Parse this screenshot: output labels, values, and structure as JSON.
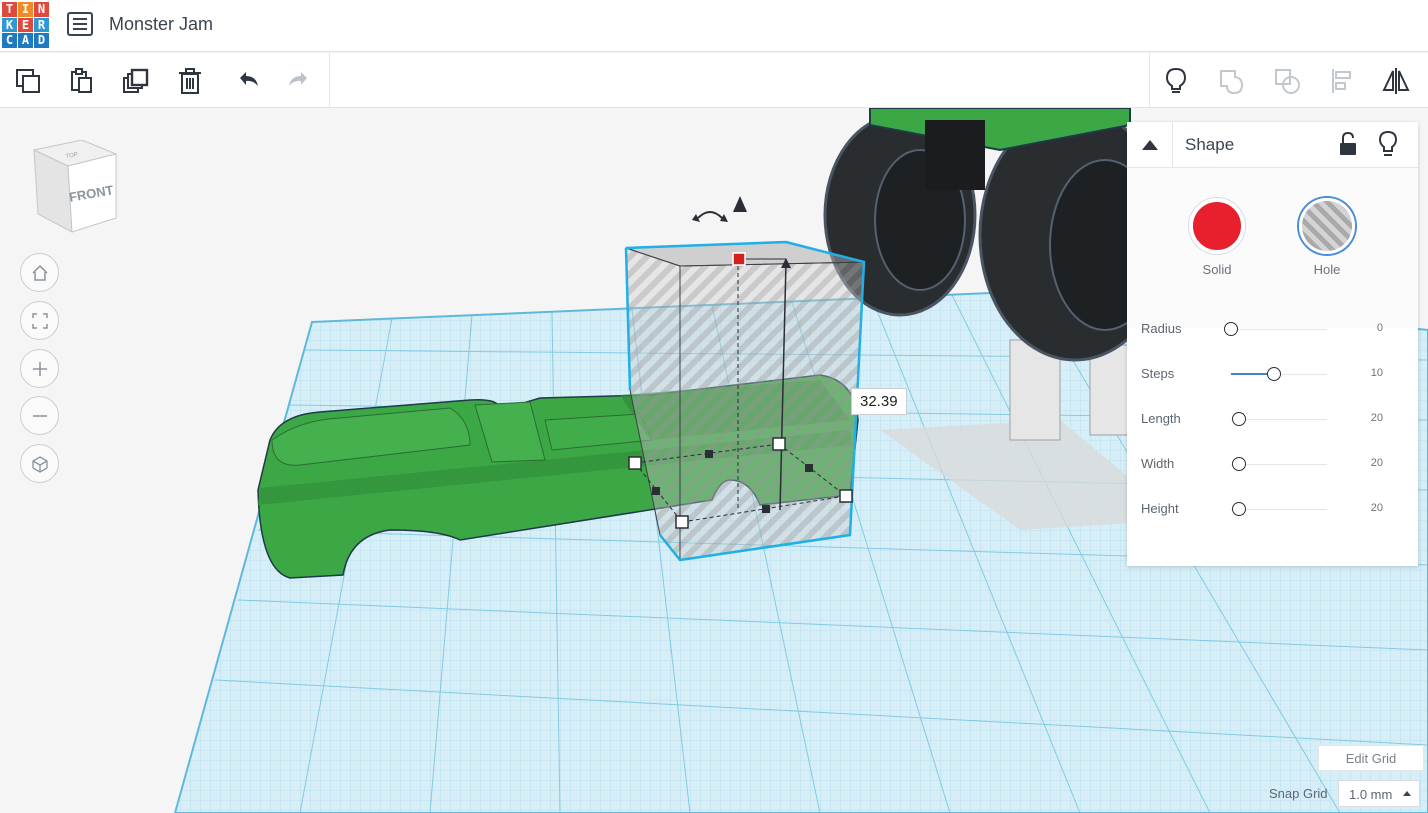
{
  "app": {
    "logo_letters": [
      "T",
      "I",
      "N",
      "K",
      "E",
      "R",
      "C",
      "A",
      "D"
    ],
    "logo_colors": [
      "#e04a3c",
      "#ef8a26",
      "#e04a3c",
      "#2d9ad6",
      "#e04a3c",
      "#2d9ad6",
      "#1f7ac0",
      "#1f7ac0",
      "#1f7ac0"
    ],
    "project_title": "Monster Jam"
  },
  "toolbar": {
    "left_buttons": [
      "copy-icon",
      "paste-icon",
      "duplicate-icon",
      "trash-icon",
      "undo-icon",
      "redo-icon"
    ],
    "right_buttons": [
      "lightbulb-icon",
      "group-icon",
      "ungroup-icon",
      "align-icon",
      "mirror-icon"
    ]
  },
  "viewcube": {
    "face_label": "FRONT",
    "top_label": "TOP"
  },
  "view_controls": [
    "home-view-icon",
    "fit-view-icon",
    "zoom-in-icon",
    "zoom-out-icon",
    "perspective-icon"
  ],
  "dimension_readout": "32.39",
  "shape_panel": {
    "title": "Shape",
    "solid_label": "Solid",
    "hole_label": "Hole",
    "solid_color": "#e8202e",
    "selected_mode": "Hole",
    "params": [
      {
        "label": "Radius",
        "value": "0",
        "fraction": 0.0
      },
      {
        "label": "Steps",
        "value": "10",
        "fraction": 0.45
      },
      {
        "label": "Length",
        "value": "20",
        "fraction": 0.08
      },
      {
        "label": "Width",
        "value": "20",
        "fraction": 0.08
      },
      {
        "label": "Height",
        "value": "20",
        "fraction": 0.08
      }
    ]
  },
  "grid": {
    "edit_grid_label": "Edit Grid",
    "snap_grid_label": "Snap Grid",
    "snap_value": "1.0 mm"
  }
}
